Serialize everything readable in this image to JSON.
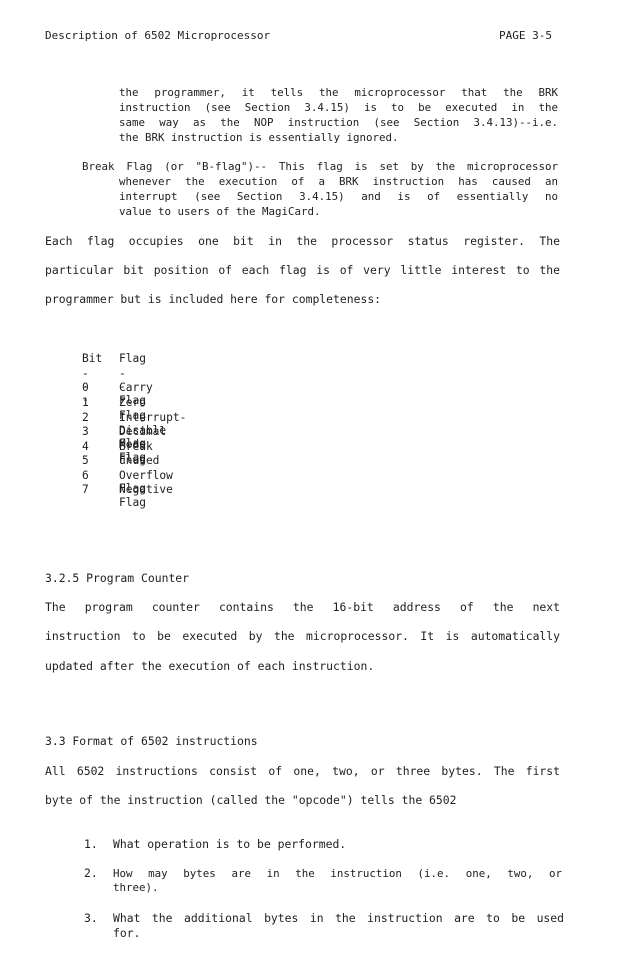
{
  "header": {
    "title": "Description of 6502 Microprocessor",
    "page": "PAGE 3-5"
  },
  "cont": {
    "lines": [
      "the programmer, it tells the microprocessor that the BRK",
      "instruction (see Section 3.4.15) is to be executed in the",
      "same way as the NOP instruction (see Section 3.4.13)--i.e.",
      "the BRK instruction is essentially ignored."
    ]
  },
  "break_flag": {
    "first": "Break Flag (or \"B-flag\")-- This flag is set by the microprocessor",
    "lines": [
      "whenever the execution of a BRK instruction has caused an",
      "interrupt (see Section 3.4.15) and is of essentially no",
      "value to users of the MagiCard."
    ]
  },
  "para1": {
    "lines": [
      "Each flag occupies one bit in the processor status register.  The",
      "particular bit position of each flag is of very little interest to the",
      "programmer but is included here for completeness:"
    ]
  },
  "bit_table": {
    "header_bit": "Bit",
    "header_flag": "Flag",
    "rule_bit": "---",
    "rule_flag": "----",
    "rows": [
      {
        "bit": "0",
        "flag": "Carry Flag"
      },
      {
        "bit": "1",
        "flag": "Zero Flag"
      },
      {
        "bit": "2",
        "flag": "Interrupt-Disable Flag"
      },
      {
        "bit": "3",
        "flag": "Decimal Mode Flag"
      },
      {
        "bit": "4",
        "flag": "Break Flag"
      },
      {
        "bit": "5",
        "flag": "unused"
      },
      {
        "bit": "6",
        "flag": "Overflow Flag"
      },
      {
        "bit": "7",
        "flag": "Negative Flag"
      }
    ]
  },
  "sec_325": {
    "heading": "3.2.5  Program Counter",
    "lines": [
      "The program counter contains the 16-bit address of the next",
      "instruction to be executed by the microprocessor.  It is automatically",
      "updated after the execution of each instruction."
    ]
  },
  "sec_33": {
    "heading": "3.3  Format of 6502 instructions",
    "lines": [
      "All 6502 instructions consist of one, two, or three bytes.  The first",
      "byte of the instruction (called the \"opcode\") tells the 6502"
    ]
  },
  "numbered": [
    {
      "n": "1.",
      "lines": [
        "What operation is to be performed."
      ]
    },
    {
      "n": "2.",
      "lines": [
        "How may bytes are in the instruction (i.e. one, two, or",
        "three)."
      ]
    },
    {
      "n": "3.",
      "lines": [
        "What the additional bytes in the instruction are to be used",
        "for."
      ]
    }
  ]
}
